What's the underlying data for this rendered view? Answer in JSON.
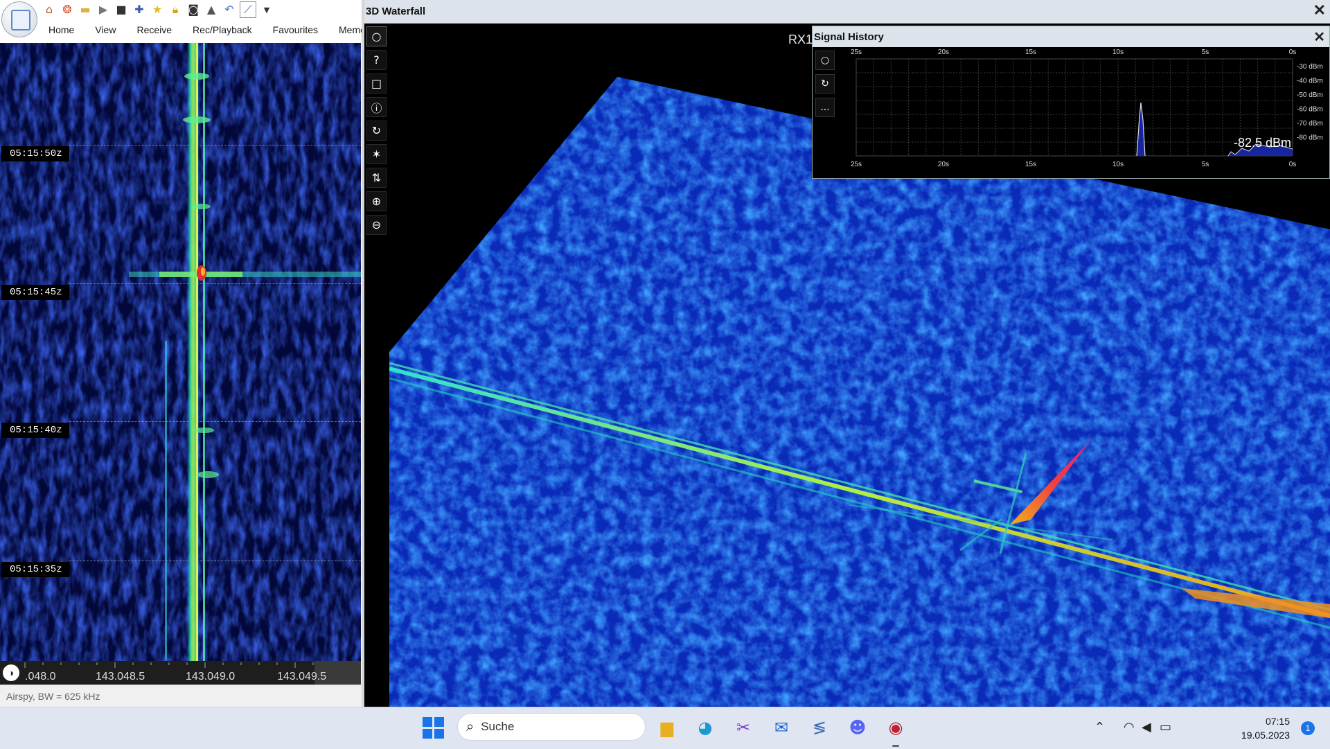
{
  "quick_access": {
    "icons": [
      "home-icon",
      "lifebuoy-icon",
      "folder-icon",
      "play-icon",
      "stop-icon",
      "add-icon",
      "star-icon",
      "lock-icon",
      "camera-icon",
      "rocket-icon",
      "undo-icon",
      "chart-icon",
      "dropdown-icon"
    ]
  },
  "menu": {
    "items": [
      "Home",
      "View",
      "Receive",
      "Rec/Playback",
      "Favourites",
      "Memorie"
    ]
  },
  "waterfall2d": {
    "timestamps": [
      "05:15:50z",
      "05:15:45z",
      "05:15:40z",
      "05:15:35z"
    ],
    "freq_labels": [
      ".048.0",
      "143.048.5",
      "143.049.0",
      "143.049.5"
    ],
    "status": "Airspy, BW = 625 kHz"
  },
  "waterfall3d": {
    "title": "3D Waterfall",
    "close": "✕",
    "receiver_label": "RX1",
    "toolbar_icons": [
      "circle-icon",
      "help-icon",
      "square-icon",
      "info-icon",
      "rotate-icon",
      "star-icon",
      "sort-icon",
      "zoom-in-icon",
      "zoom-out-icon"
    ],
    "toolbar_glyphs": [
      "○",
      "?",
      "□",
      "ⓘ",
      "↻",
      "✶",
      "⇅",
      "⊕",
      "⊖"
    ]
  },
  "signal_history": {
    "title": "Signal History",
    "close": "✕",
    "tool_glyphs": [
      "○",
      "↻",
      "..."
    ],
    "x_labels": [
      "25s",
      "20s",
      "15s",
      "10s",
      "5s",
      "0s"
    ],
    "y_labels": [
      "-30 dBm",
      "-40 dBm",
      "-50 dBm",
      "-60 dBm",
      "-70 dBm",
      "-80 dBm"
    ],
    "readout": "-82.5 dBm"
  },
  "taskbar": {
    "search_placeholder": "Suche",
    "apps": [
      "file-explorer-icon",
      "edge-icon",
      "snipping-tool-icon",
      "mail-icon",
      "app-icon",
      "discord-icon",
      "sdr-app-icon"
    ],
    "time": "07:15",
    "date": "19.05.2023",
    "notifications": "1"
  }
}
